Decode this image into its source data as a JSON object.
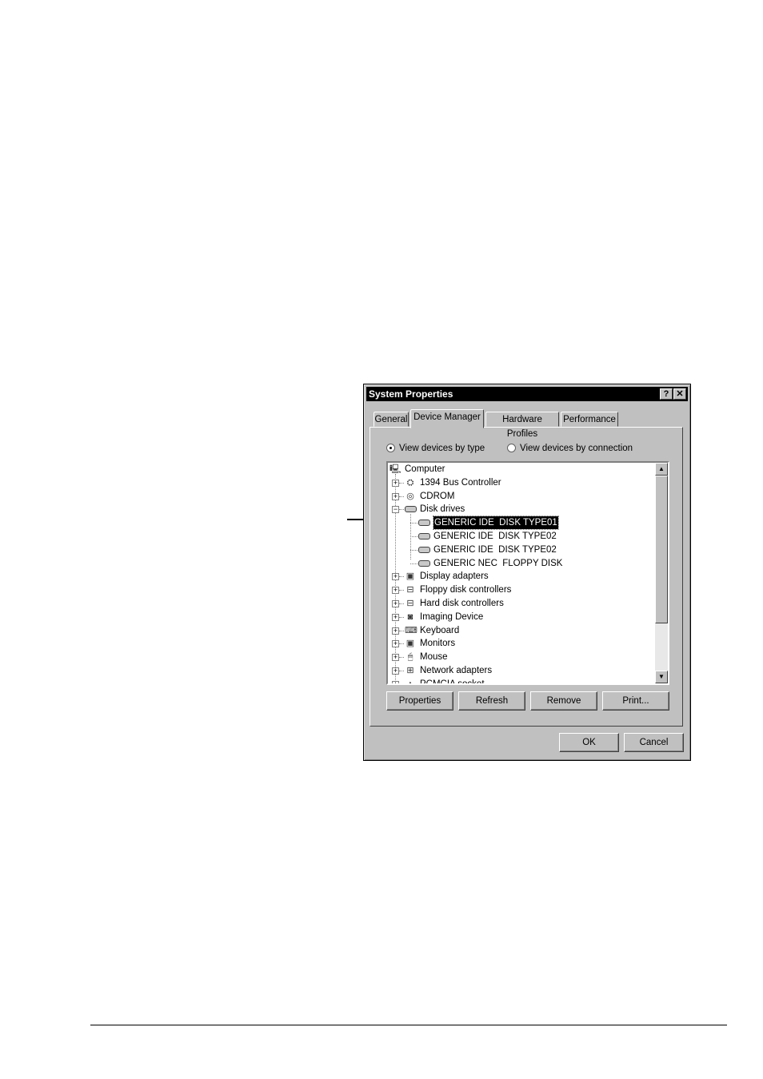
{
  "window": {
    "title": "System Properties",
    "help_button": "?",
    "close_button": "✕"
  },
  "tabs": [
    {
      "label": "General",
      "active": false
    },
    {
      "label": "Device Manager",
      "active": true
    },
    {
      "label": "Hardware Profiles",
      "active": false
    },
    {
      "label": "Performance",
      "active": false
    }
  ],
  "view_options": {
    "by_type": {
      "label": "View devices by type",
      "selected": true
    },
    "by_connection": {
      "label": "View devices by connection",
      "selected": false
    }
  },
  "tree": {
    "root": "Computer",
    "items": [
      {
        "label": "1394 Bus Controller",
        "expander": "+",
        "icon": "bus-icon"
      },
      {
        "label": "CDROM",
        "expander": "+",
        "icon": "cdrom-icon"
      },
      {
        "label": "Disk drives",
        "expander": "−",
        "icon": "disk-icon"
      },
      {
        "label": "GENERIC IDE  DISK TYPE01",
        "child": true,
        "selected": true,
        "icon": "disk-icon"
      },
      {
        "label": "GENERIC IDE  DISK TYPE02",
        "child": true,
        "icon": "disk-icon"
      },
      {
        "label": "GENERIC IDE  DISK TYPE02",
        "child": true,
        "icon": "disk-icon"
      },
      {
        "label": "GENERIC NEC  FLOPPY DISK",
        "child": true,
        "icon": "disk-icon"
      },
      {
        "label": "Display adapters",
        "expander": "+",
        "icon": "monitor-icon"
      },
      {
        "label": "Floppy disk controllers",
        "expander": "+",
        "icon": "floppy-controller-icon"
      },
      {
        "label": "Hard disk controllers",
        "expander": "+",
        "icon": "disk-controller-icon"
      },
      {
        "label": "Imaging Device",
        "expander": "+",
        "icon": "camera-icon"
      },
      {
        "label": "Keyboard",
        "expander": "+",
        "icon": "keyboard-icon"
      },
      {
        "label": "Monitors",
        "expander": "+",
        "icon": "monitor-icon"
      },
      {
        "label": "Mouse",
        "expander": "+",
        "icon": "mouse-icon"
      },
      {
        "label": "Network adapters",
        "expander": "+",
        "icon": "network-icon"
      },
      {
        "label": "PCMCIA socket",
        "expander": "+",
        "icon": "pcmcia-icon"
      }
    ]
  },
  "scrollbar": {
    "up": "▲",
    "down": "▼"
  },
  "buttons": {
    "properties": "Properties",
    "refresh": "Refresh",
    "remove": "Remove",
    "print": "Print...",
    "ok": "OK",
    "cancel": "Cancel"
  }
}
